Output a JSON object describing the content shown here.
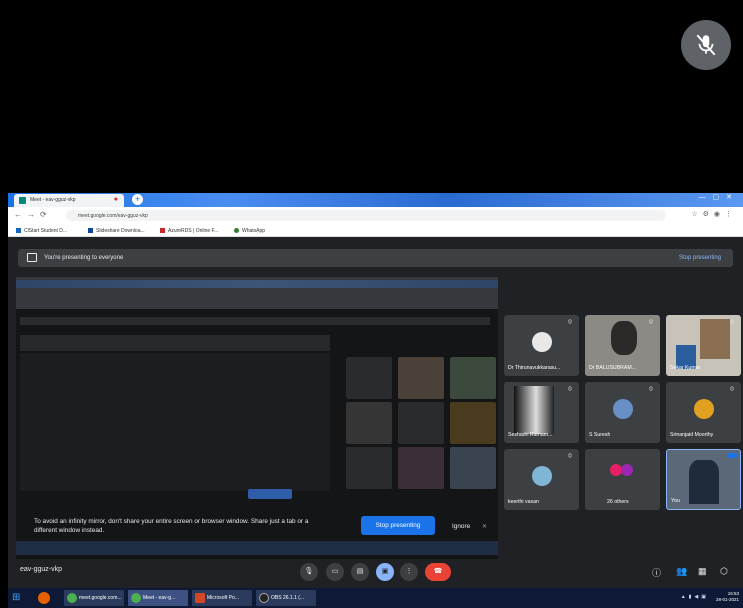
{
  "browser": {
    "tab_title": "Meet - eav-gguz-vkp",
    "address": "meet.google.com/eav-gguz-vkp",
    "bookmarks": [
      "ClStart Student D...",
      "Slideshare Downloa...",
      "AzureRDS | Online F...",
      "WhatsApp"
    ]
  },
  "presenting": {
    "banner_text": "You're presenting to everyone",
    "stop_label": "Stop presenting",
    "warning": "To avoid an infinity mirror, don't share your entire screen or browser window. Share just a tab or a different window instead.",
    "stop_button": "Stop presenting",
    "ignore_label": "Ignore"
  },
  "participants": [
    {
      "name": "Dr Thirunavukkarasu..."
    },
    {
      "name": "Dr BALUSUBRAM..."
    },
    {
      "name": "Sekar Kumar"
    },
    {
      "name": "Seshadri Ramam..."
    },
    {
      "name": "S Suresh"
    },
    {
      "name": "Srinanjaid Moorthy"
    },
    {
      "name": "keerthi vasan"
    },
    {
      "name": "26 others"
    },
    {
      "name": "You"
    }
  ],
  "controls": {
    "meeting_code": "eav-gguz-vkp"
  },
  "taskbar": {
    "items": [
      "meet.google.com...",
      "Meet - eav-g...",
      "Microsoft Po...",
      "OBS 26.1.1 (..."
    ],
    "time": "16:53",
    "date": "28-01-2021"
  },
  "colors": {
    "meet_bg": "#202124",
    "accent_blue": "#1a73e8",
    "end_call_red": "#ea4335",
    "tile_bg": "#3c4043"
  }
}
